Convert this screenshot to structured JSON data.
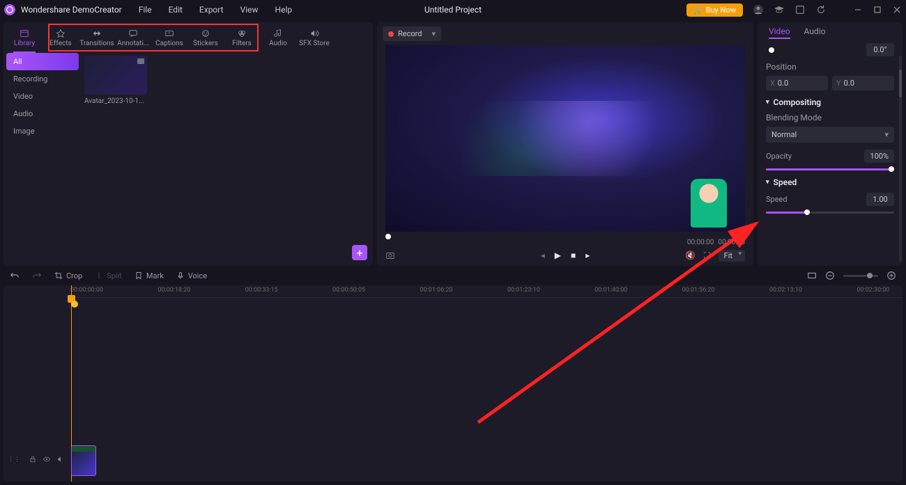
{
  "app_name": "Wondershare DemoCreator",
  "menu": {
    "file": "File",
    "edit": "Edit",
    "export": "Export",
    "view": "View",
    "help": "Help"
  },
  "project_title": "Untitled Project",
  "buy_now": "Buy Now",
  "export_btn": "Export",
  "tabs": {
    "library": "Library",
    "effects": "Effects",
    "transitions": "Transitions",
    "annotations": "Annotati...",
    "captions": "Captions",
    "stickers": "Stickers",
    "filters": "Filters",
    "audio": "Audio",
    "sfx": "SFX Store"
  },
  "lib_categories": {
    "all": "All",
    "recording": "Recording",
    "video": "Video",
    "audio": "Audio",
    "image": "Image"
  },
  "clip_name": "Avatar_2023-10-1...",
  "record_label": "Record",
  "preview": {
    "time_current": "00:00:00",
    "time_total": "00:00:05",
    "fit": "Fit"
  },
  "props": {
    "tab_video": "Video",
    "tab_audio": "Audio",
    "rotate_val": "0.0°",
    "position_label": "Position",
    "pos_x": "0.0",
    "pos_y": "0.0",
    "compositing": "Compositing",
    "blend_label": "Blending Mode",
    "blend_value": "Normal",
    "opacity_label": "Opacity",
    "opacity_value": "100%",
    "speed_section": "Speed",
    "speed_label": "Speed",
    "speed_value": "1.00"
  },
  "tl_tools": {
    "crop": "Crop",
    "split": "Split",
    "mark": "Mark",
    "voice": "Voice"
  },
  "ruler": [
    "00:00:00:00",
    "00:00:18:20",
    "00:00:33:15",
    "00:00:50:05",
    "00:01:06:20",
    "00:01:23:10",
    "00:01:40:00",
    "00:01:56:20",
    "00:02:13:10",
    "00:02:30:00"
  ],
  "chart_data": null
}
